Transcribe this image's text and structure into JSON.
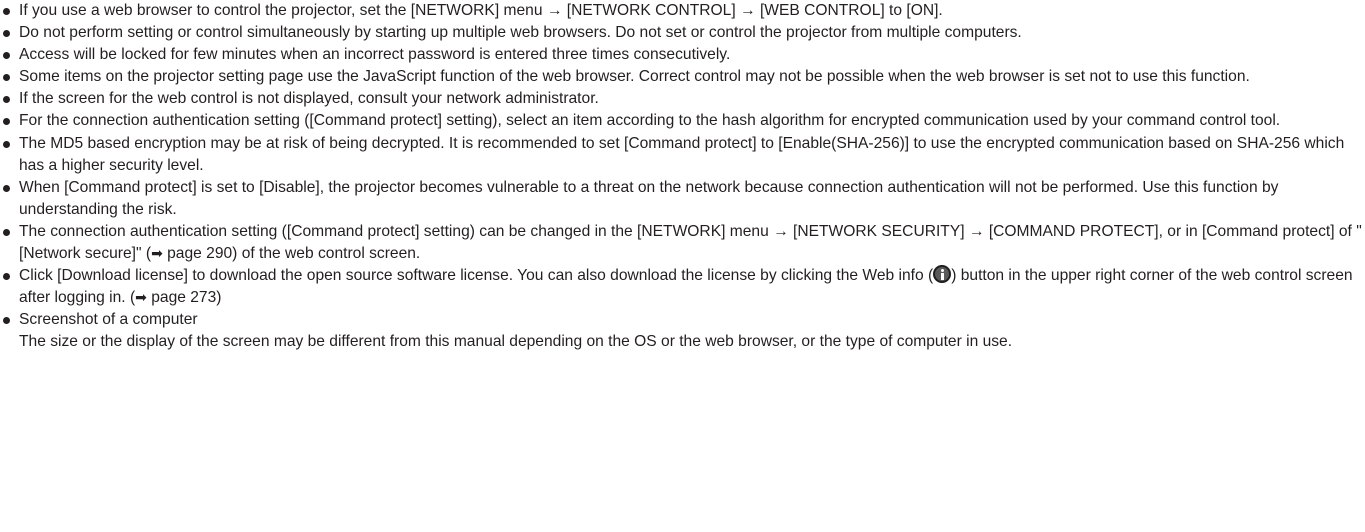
{
  "notes": [
    {
      "text": "If you use a web browser to control the projector, set the [NETWORK] menu → [NETWORK CONTROL] → [WEB CONTROL] to [ON]."
    },
    {
      "text": "Do not perform setting or control simultaneously by starting up multiple web browsers. Do not set or control the projector from multiple computers."
    },
    {
      "text": "Access will be locked for few minutes when an incorrect password is entered three times consecutively."
    },
    {
      "text": "Some items on the projector setting page use the JavaScript function of the web browser. Correct control may not be possible when the web browser is set not to use this function."
    },
    {
      "text": "If the screen for the web control is not displayed, consult your network administrator."
    },
    {
      "text": "For the connection authentication setting ([Command protect] setting), select an item according to the hash algorithm for encrypted communication used by your command control tool."
    },
    {
      "text": "The MD5 based encryption may be at risk of being decrypted. It is recommended to set [Command protect] to [Enable(SHA-256)] to use the encrypted communication based on SHA-256 which has a higher security level."
    },
    {
      "text": "When [Command protect] is set to [Disable], the projector becomes vulnerable to a threat on the network because connection authentication will not be performed. Use this function by understanding the risk."
    },
    {
      "part1": "The connection authentication setting ([Command protect] setting) can be changed in the [NETWORK] menu → [NETWORK SECURITY] → [COMMAND PROTECT], or in [Command protect] of \"[Network secure]\" (",
      "arrow": "➡",
      "part2": " page 290) of the web control screen."
    },
    {
      "part1": "Click [Download license] to download the open source software license. You can also download the license by clicking the Web info (",
      "icon": "info-icon",
      "part2": ") button in the upper right corner of the web control screen after logging in. (",
      "arrow": "➡",
      "part3": " page 273)"
    },
    {
      "title": "Screenshot of a computer",
      "text": "The size or the display of the screen may be different from this manual depending on the OS or the web browser, or the type of computer in use."
    }
  ]
}
